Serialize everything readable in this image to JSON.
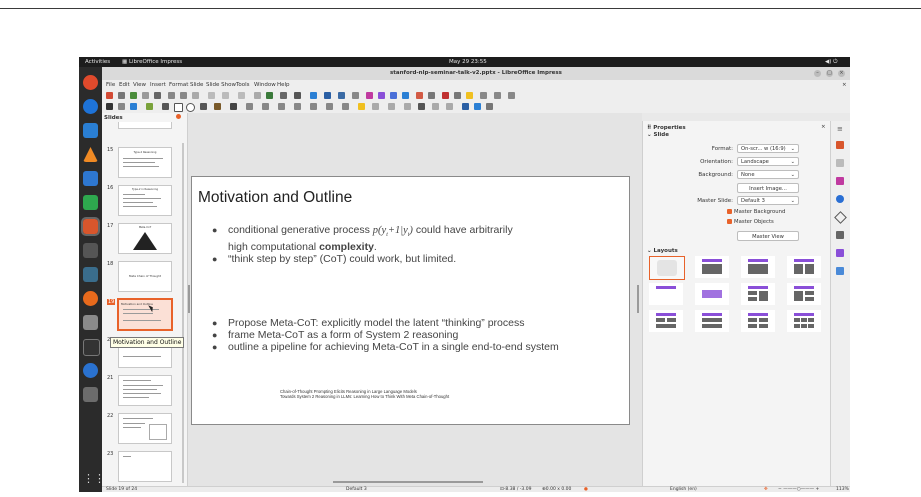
{
  "topbar": {
    "activities": "Activities",
    "app_name": "LibreOffice Impress",
    "clock": "May 29  23:55"
  },
  "window": {
    "title": "stanford-nlp-seminar-talk-v2.pptx - LibreOffice Impress"
  },
  "menu": [
    "File",
    "Edit",
    "View",
    "Insert",
    "Format",
    "Slide",
    "Slide Show",
    "Tools",
    "Window",
    "Help"
  ],
  "slides_panel": {
    "title": "Slides",
    "thumbs": [
      {
        "num": "15",
        "caption": "Type-2 Reasoning"
      },
      {
        "num": "16",
        "caption": "Type-2 in Reasoning"
      },
      {
        "num": "17",
        "caption": "Meta-CoT"
      },
      {
        "num": "18",
        "caption": "Meta Chain of Thought"
      },
      {
        "num": "19",
        "caption": "Motivation and Outline"
      },
      {
        "num": "20",
        "caption": ""
      },
      {
        "num": "21",
        "caption": ""
      },
      {
        "num": "22",
        "caption": ""
      },
      {
        "num": "23",
        "caption": ""
      }
    ],
    "tooltip": "Motivation and Outline"
  },
  "slide": {
    "title": "Motivation and Outline",
    "bullets_top": [
      {
        "pre": "conditional generative process ",
        "math": "p(y",
        "math_sub1": "t",
        "math2": "+1|y",
        "math_sub2": "t",
        "math3": ")",
        "post": " could have arbitrarily",
        "line2_pre": "high computational ",
        "line2_bold": "complexity",
        "line2_post": "."
      },
      {
        "text": "“think step by step” (CoT) could work, but limited."
      }
    ],
    "bullets_bottom": [
      "Propose Meta-CoT: explicitly model the latent “thinking” process",
      "frame Meta-CoT as a form of System 2 reasoning",
      "outline a pipeline for achieving Meta-CoT in a single end-to-end system"
    ],
    "references": [
      "Chain-of-Thought Prompting Elicits Reasoning in Large Language Models",
      "Towards System 2 Reasoning in LLMs: Learning How to Think With Meta Chain-of-Thought"
    ]
  },
  "properties": {
    "title": "Properties",
    "section": "Slide",
    "format_label": "Format:",
    "format_value": "On-scr...  w (16:9)",
    "orientation_label": "Orientation:",
    "orientation_value": "Landscape",
    "background_label": "Background:",
    "background_value": "None",
    "insert_image": "Insert Image...",
    "master_slide_label": "Master Slide:",
    "master_slide_value": "Default 3",
    "master_background": "Master Background",
    "master_objects": "Master Objects",
    "master_view": "Master View",
    "layouts_title": "Layouts"
  },
  "status": {
    "slide_of": "Slide 19 of 24",
    "master": "Default 3",
    "position": "-8.38 / -3.09",
    "size": "0.00 x 0.00",
    "language": "English (en)",
    "zoom": "113%"
  },
  "colors": {
    "accent": "#e8622a",
    "layout_bar": "#8a4fd8",
    "dock": "#2b2b2b"
  }
}
